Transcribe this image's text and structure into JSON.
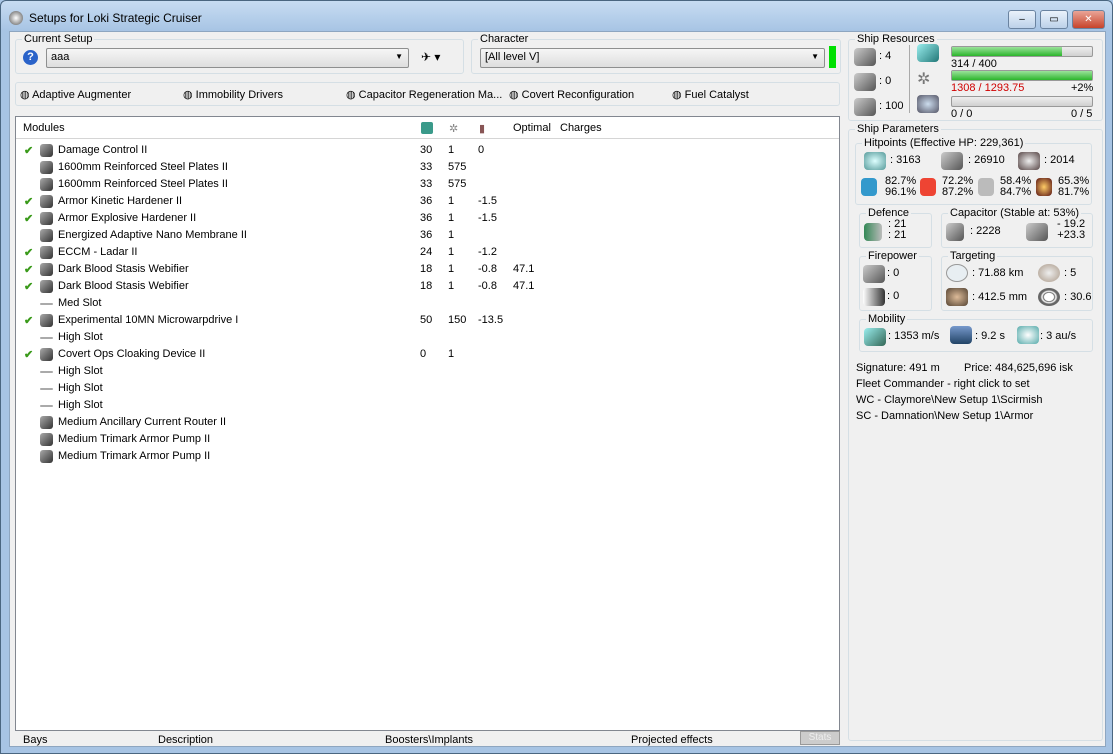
{
  "window": {
    "title": "Setups for Loki Strategic Cruiser",
    "minimize": "–",
    "maximize": "▭",
    "close": "✕"
  },
  "setup": {
    "label": "Current Setup",
    "value": "aaa",
    "help_icon": "?"
  },
  "character": {
    "label": "Character",
    "value": "[All level V]",
    "status_color": "#00e000"
  },
  "subsystems": [
    "Adaptive Augmenter",
    "Immobility Drivers",
    "Capacitor Regeneration Ma...",
    "Covert Reconfiguration",
    "Fuel Catalyst"
  ],
  "modules": {
    "headers": {
      "name": "Modules",
      "optimal": "Optimal",
      "charges": "Charges"
    },
    "rows": [
      {
        "checked": true,
        "name": "Damage Control II",
        "cpu": "30",
        "pg": "1",
        "cap": "0",
        "optimal": ""
      },
      {
        "checked": false,
        "name": "1600mm Reinforced Steel Plates II",
        "cpu": "33",
        "pg": "575",
        "cap": "",
        "optimal": ""
      },
      {
        "checked": false,
        "name": "1600mm Reinforced Steel Plates II",
        "cpu": "33",
        "pg": "575",
        "cap": "",
        "optimal": ""
      },
      {
        "checked": true,
        "name": "Armor Kinetic Hardener II",
        "cpu": "36",
        "pg": "1",
        "cap": "-1.5",
        "optimal": ""
      },
      {
        "checked": true,
        "name": "Armor Explosive Hardener II",
        "cpu": "36",
        "pg": "1",
        "cap": "-1.5",
        "optimal": ""
      },
      {
        "checked": false,
        "name": "Energized Adaptive Nano Membrane II",
        "cpu": "36",
        "pg": "1",
        "cap": "",
        "optimal": ""
      },
      {
        "checked": true,
        "name": "ECCM - Ladar II",
        "cpu": "24",
        "pg": "1",
        "cap": "-1.2",
        "optimal": ""
      },
      {
        "checked": true,
        "name": "Dark Blood Stasis Webifier",
        "cpu": "18",
        "pg": "1",
        "cap": "-0.8",
        "optimal": "47.1"
      },
      {
        "checked": true,
        "name": "Dark Blood Stasis Webifier",
        "cpu": "18",
        "pg": "1",
        "cap": "-0.8",
        "optimal": "47.1"
      },
      {
        "checked": false,
        "name": "Med Slot",
        "cpu": "",
        "pg": "",
        "cap": "",
        "optimal": "",
        "empty": true
      },
      {
        "checked": true,
        "name": "Experimental 10MN Microwarpdrive I",
        "cpu": "50",
        "pg": "150",
        "cap": "-13.5",
        "optimal": ""
      },
      {
        "checked": false,
        "name": "High Slot",
        "cpu": "",
        "pg": "",
        "cap": "",
        "optimal": "",
        "empty": true
      },
      {
        "checked": true,
        "name": "Covert Ops Cloaking Device II",
        "cpu": "0",
        "pg": "1",
        "cap": "",
        "optimal": ""
      },
      {
        "checked": false,
        "name": "High Slot",
        "cpu": "",
        "pg": "",
        "cap": "",
        "optimal": "",
        "empty": true
      },
      {
        "checked": false,
        "name": "High Slot",
        "cpu": "",
        "pg": "",
        "cap": "",
        "optimal": "",
        "empty": true
      },
      {
        "checked": false,
        "name": "High Slot",
        "cpu": "",
        "pg": "",
        "cap": "",
        "optimal": "",
        "empty": true
      },
      {
        "checked": false,
        "name": "Medium Ancillary Current Router II",
        "cpu": "",
        "pg": "",
        "cap": "",
        "optimal": ""
      },
      {
        "checked": false,
        "name": "Medium Trimark Armor Pump II",
        "cpu": "",
        "pg": "",
        "cap": "",
        "optimal": ""
      },
      {
        "checked": false,
        "name": "Medium Trimark Armor Pump II",
        "cpu": "",
        "pg": "",
        "cap": "",
        "optimal": ""
      }
    ]
  },
  "bottom_tabs": [
    "Bays",
    "Description",
    "Boosters\\Implants",
    "Projected effects",
    "Stats"
  ],
  "resources": {
    "label": "Ship Resources",
    "turrets": ": 4",
    "launchers": ": 0",
    "drone_bw": ": 100",
    "cpu": {
      "text": "314 / 400",
      "fraction": 0.785
    },
    "pg": {
      "text": "1308 / 1293.75",
      "extra": "+2%",
      "fraction": 1.0,
      "over_color": "#d00000"
    },
    "calib": {
      "text": "0 / 0",
      "extra": "0 / 5",
      "fraction": 0
    }
  },
  "params": {
    "label": "Ship Parameters",
    "hp": {
      "label": "Hitpoints (Effective HP: 229,361)",
      "shield": ": 3163",
      "armor": ": 26910",
      "structure": ": 2014",
      "resists": [
        [
          "82.7%",
          "96.1%"
        ],
        [
          "72.2%",
          "87.2%"
        ],
        [
          "58.4%",
          "84.7%"
        ],
        [
          "65.3%",
          "81.7%"
        ]
      ]
    },
    "defence": {
      "label": "Defence",
      "a": ": 21",
      "b": ": 21"
    },
    "capacitor": {
      "label": "Capacitor (Stable at: 53%)",
      "amount": ": 2228",
      "use": "- 19.2",
      "regen": "+23.3"
    },
    "firepower": {
      "label": "Firepower",
      "turret": ": 0",
      "missile": ": 0"
    },
    "targeting": {
      "label": "Targeting",
      "range": ": 71.88 km",
      "targets": ": 5",
      "res": ": 412.5 mm",
      "scan": ": 30.6"
    },
    "mobility": {
      "label": "Mobility",
      "speed": ": 1353 m/s",
      "align": ": 9.2 s",
      "warp": ": 3 au/s"
    },
    "signature": "Signature: 491 m",
    "price": "Price: 484,625,696 isk",
    "fleet": "Fleet Commander - right click to set",
    "wc": "WC - Claymore\\New Setup 1\\Scirmish",
    "sc": "SC - Damnation\\New Setup 1\\Armor"
  }
}
